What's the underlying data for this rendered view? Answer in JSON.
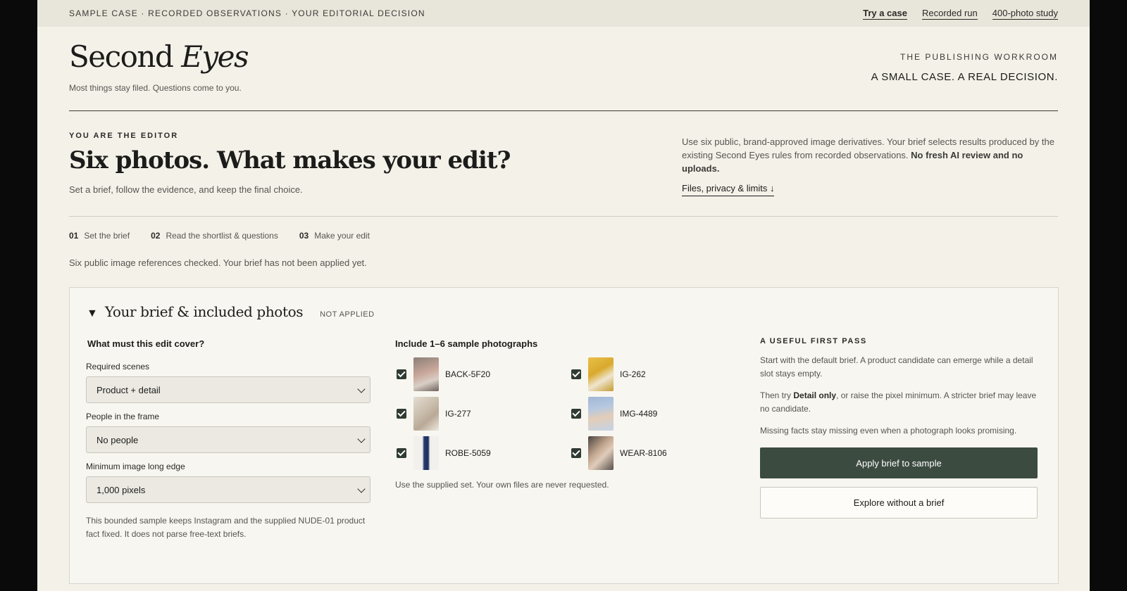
{
  "topbar": {
    "crumbs": "SAMPLE CASE · RECORDED OBSERVATIONS · YOUR EDITORIAL DECISION",
    "links": [
      "Try a case",
      "Recorded run",
      "400-photo study"
    ]
  },
  "masthead": {
    "brand_main": "Second ",
    "brand_italic": "Eyes",
    "tagline": "Most things stay filed. Questions come to you.",
    "kicker": "THE PUBLISHING WORKROOM",
    "slogan": "A SMALL CASE. A REAL DECISION."
  },
  "intro": {
    "eyebrow": "YOU ARE THE EDITOR",
    "headline": "Six photos. What makes your edit?",
    "subline": "Set a brief, follow the evidence, and keep the final choice.",
    "desc": "Use six public, brand-approved image derivatives. Your brief selects results produced by the existing Second Eyes rules from recorded observations.",
    "desc_bold": "No fresh AI review and no uploads.",
    "link": "Files, privacy & limits ↓"
  },
  "steps": [
    {
      "num": "01",
      "label": "Set the brief"
    },
    {
      "num": "02",
      "label": "Read the shortlist & questions"
    },
    {
      "num": "03",
      "label": "Make your edit"
    }
  ],
  "status": "Six public image references checked. Your brief has not been applied yet.",
  "panel": {
    "caret": "▼",
    "title": "Your brief & included photos",
    "badge": "NOT APPLIED",
    "brief": {
      "heading": "What must this edit cover?",
      "scenes_label": "Required scenes",
      "scenes_value": "Product + detail",
      "people_label": "People in the frame",
      "people_value": "No people",
      "min_label": "Minimum image long edge",
      "min_value": "1,000 pixels",
      "note": "This bounded sample keeps Instagram and the supplied NUDE-01 product fact fixed. It does not parse free-text briefs."
    },
    "photos": {
      "heading": "Include 1–6 sample photographs",
      "items": [
        {
          "label": "BACK-5F20",
          "checked": true
        },
        {
          "label": "IG-262",
          "checked": true
        },
        {
          "label": "IG-277",
          "checked": true
        },
        {
          "label": "IMG-4489",
          "checked": true
        },
        {
          "label": "ROBE-5059",
          "checked": true
        },
        {
          "label": "WEAR-8106",
          "checked": true
        }
      ],
      "note": "Use the supplied set. Your own files are never requested."
    },
    "guide": {
      "kicker": "A USEFUL FIRST PASS",
      "p1": "Start with the default brief. A product candidate can emerge while a detail slot stays empty.",
      "p2_pre": "Then try ",
      "p2_bold": "Detail only",
      "p2_post": ", or raise the pixel minimum. A stricter brief may leave no candidate.",
      "p3": "Missing facts stay missing even when a photograph looks promising.",
      "apply_button": "Apply brief to sample",
      "explore_button": "Explore without a brief"
    }
  },
  "colors": {
    "page_bg": "#f4f1e9",
    "topbar_bg": "#e8e5db",
    "primary_button": "#3c4b40",
    "checkbox": "#2f3b33"
  }
}
